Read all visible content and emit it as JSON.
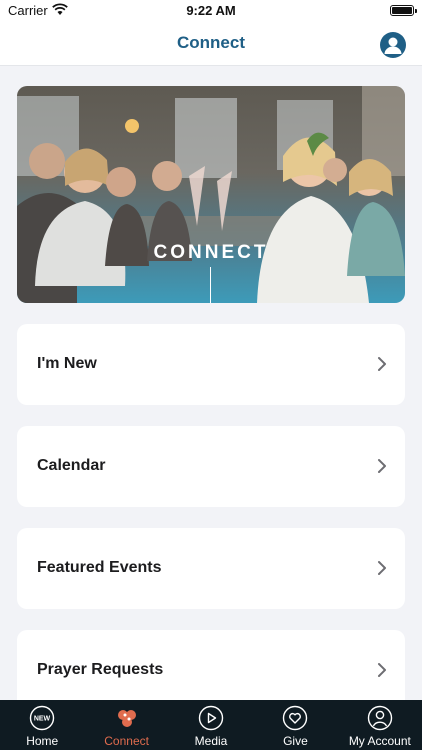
{
  "status_bar": {
    "carrier": "Carrier",
    "time": "9:22 AM"
  },
  "nav": {
    "title": "Connect"
  },
  "hero": {
    "caption": "CONNECT"
  },
  "cards": [
    {
      "label": "I'm New"
    },
    {
      "label": "Calendar"
    },
    {
      "label": "Featured Events"
    },
    {
      "label": "Prayer Requests"
    }
  ],
  "tabs": [
    {
      "label": "Home",
      "icon": "new-badge-icon",
      "badge": "NEW"
    },
    {
      "label": "Connect",
      "icon": "connect-cluster-icon",
      "active": true
    },
    {
      "label": "Media",
      "icon": "play-circle-icon"
    },
    {
      "label": "Give",
      "icon": "heart-circle-icon"
    },
    {
      "label": "My Account",
      "icon": "person-circle-icon"
    }
  ],
  "colors": {
    "accent": "#1f5f86",
    "active_tab": "#e06c4e",
    "tab_bar": "#0f1b22",
    "background": "#f2f3f7"
  }
}
